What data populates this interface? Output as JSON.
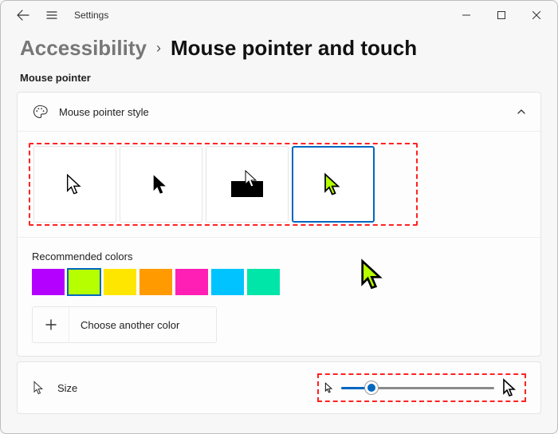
{
  "titlebar": {
    "app_name": "Settings"
  },
  "breadcrumb": {
    "parent": "Accessibility",
    "separator": "›",
    "current": "Mouse pointer and touch"
  },
  "section_heading": "Mouse pointer",
  "pointer_style": {
    "label": "Mouse pointer style",
    "options": [
      "white",
      "black",
      "inverted",
      "custom"
    ],
    "selected_index": 3
  },
  "colors": {
    "title": "Recommended colors",
    "swatches": [
      "#b400ff",
      "#b6ff00",
      "#ffe600",
      "#ff9a00",
      "#ff1fb4",
      "#00c3ff",
      "#00e6a8"
    ],
    "selected_index": 1,
    "choose_another_label": "Choose another color"
  },
  "size": {
    "label": "Size",
    "value_percent": 20
  }
}
